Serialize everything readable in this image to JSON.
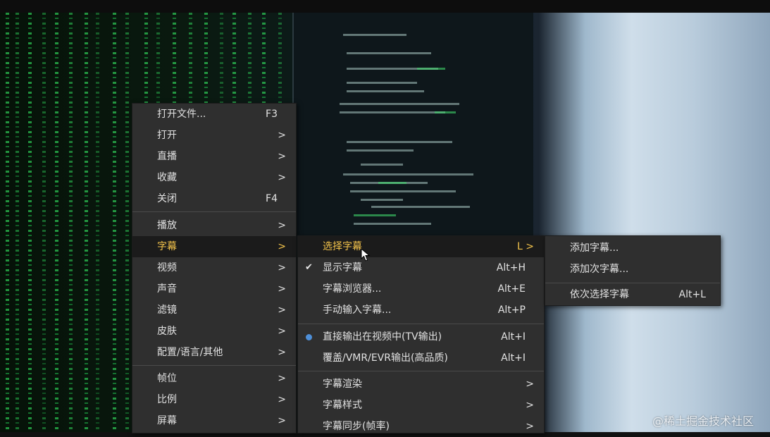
{
  "menu_main": {
    "items": [
      {
        "label": "打开文件...",
        "accel": "F3"
      },
      {
        "label": "打开",
        "accel": ">"
      },
      {
        "label": "直播",
        "accel": ">"
      },
      {
        "label": "收藏",
        "accel": ">"
      },
      {
        "label": "关闭",
        "accel": "F4"
      },
      {
        "label": "播放",
        "accel": ">"
      },
      {
        "label": "字幕",
        "accel": ">"
      },
      {
        "label": "视频",
        "accel": ">"
      },
      {
        "label": "声音",
        "accel": ">"
      },
      {
        "label": "滤镜",
        "accel": ">"
      },
      {
        "label": "皮肤",
        "accel": ">"
      },
      {
        "label": "配置/语言/其他",
        "accel": ">"
      },
      {
        "label": "帧位",
        "accel": ">"
      },
      {
        "label": "比例",
        "accel": ">"
      },
      {
        "label": "屏幕",
        "accel": ">"
      }
    ]
  },
  "menu_subtitle": {
    "items": [
      {
        "label": "选择字幕",
        "accel": "L >"
      },
      {
        "label": "显示字幕",
        "accel": "Alt+H"
      },
      {
        "label": "字幕浏览器...",
        "accel": "Alt+E"
      },
      {
        "label": "手动输入字幕...",
        "accel": "Alt+P"
      },
      {
        "label": "直接输出在视频中(TV输出)",
        "accel": "Alt+I"
      },
      {
        "label": "覆盖/VMR/EVR输出(高品质)",
        "accel": "Alt+I"
      },
      {
        "label": "字幕渲染",
        "accel": ">"
      },
      {
        "label": "字幕样式",
        "accel": ">"
      },
      {
        "label": "字幕同步(帧率)",
        "accel": ">"
      }
    ]
  },
  "menu_select": {
    "items": [
      {
        "label": "添加字幕...",
        "accel": ""
      },
      {
        "label": "添加次字幕...",
        "accel": ""
      },
      {
        "label": "依次选择字幕",
        "accel": "Alt+L"
      }
    ]
  },
  "colors": {
    "menu_bg": "#2f2f2f",
    "highlight_bg": "#1b1b1b",
    "highlight_text": "#f3c34b",
    "radio": "#4e8fd8"
  },
  "watermark": "@稀土掘金技术社区"
}
